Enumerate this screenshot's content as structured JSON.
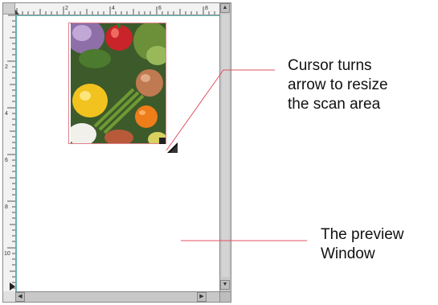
{
  "ruler": {
    "top_numbers": [
      "2",
      "4",
      "6",
      "8"
    ],
    "left_numbers": [
      "2",
      "4",
      "6",
      "8",
      "10"
    ]
  },
  "preview": {
    "image_subject": "vegetables photo (peppers, tomato, onion, asparagus, orange)"
  },
  "annotations": {
    "resize_callout": {
      "lines": [
        "Cursor turns",
        "arrow to resize",
        "the scan area"
      ]
    },
    "preview_callout": {
      "lines": [
        "The preview",
        "Window"
      ]
    }
  },
  "colors": {
    "callout_line": "#e05060",
    "scan_border": "#e0808c",
    "canvas_edge": "#5fb5b5"
  },
  "icons": {
    "scroll_up": "triangle-up",
    "scroll_down": "triangle-down",
    "scroll_left": "triangle-left",
    "scroll_right": "triangle-right",
    "cursor": "resize-arrow"
  }
}
